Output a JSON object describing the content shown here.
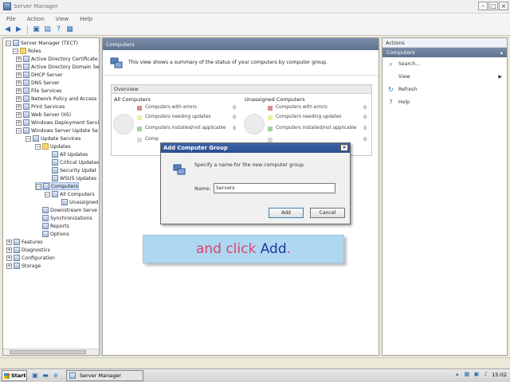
{
  "window": {
    "title": "Server Manager"
  },
  "menu": [
    "File",
    "Action",
    "View",
    "Help"
  ],
  "tree": {
    "items": [
      {
        "label": "Server Manager (TECT)"
      },
      {
        "label": "Roles"
      },
      {
        "label": "Active Directory Certificate"
      },
      {
        "label": "Active Directory Domain Se"
      },
      {
        "label": "DHCP Server"
      },
      {
        "label": "DNS Server"
      },
      {
        "label": "File Services"
      },
      {
        "label": "Network Policy and Access"
      },
      {
        "label": "Print Services"
      },
      {
        "label": "Web Server (IIS)"
      },
      {
        "label": "Windows Deployment Servi"
      },
      {
        "label": "Windows Server Update Se"
      },
      {
        "label": "Update Services"
      },
      {
        "label": "Updates"
      },
      {
        "label": "All Updates"
      },
      {
        "label": "Critical Updates"
      },
      {
        "label": "Security Updat"
      },
      {
        "label": "WSUS Updates"
      },
      {
        "label": "Computers"
      },
      {
        "label": "All Computers"
      },
      {
        "label": "Unassigned"
      },
      {
        "label": "Downstream Serve"
      },
      {
        "label": "Synchronizations"
      },
      {
        "label": "Reports"
      },
      {
        "label": "Options"
      },
      {
        "label": "Features"
      },
      {
        "label": "Diagnostics"
      },
      {
        "label": "Configuration"
      },
      {
        "label": "Storage"
      }
    ]
  },
  "center": {
    "header": "Computers",
    "description": "This view shows a summary of the status of your computers by computer group.",
    "overview_title": "Overview",
    "all": {
      "title": "All Computers",
      "rows": [
        {
          "label": "Computers with errors",
          "count": "0",
          "color": "#d98b91"
        },
        {
          "label": "Computers needing updates",
          "count": "0",
          "color": "#efef9d"
        },
        {
          "label": "Computers installed/not applicable",
          "count": "0",
          "color": "#9fd39a"
        },
        {
          "label": "Comp",
          "count": "",
          "color": "#d9d9d9"
        }
      ]
    },
    "unassigned": {
      "title": "Unassigned Computers",
      "rows": [
        {
          "label": "Computers with errors",
          "count": "0",
          "color": "#d98b91"
        },
        {
          "label": "Computers needing updates",
          "count": "0",
          "color": "#efef9d"
        },
        {
          "label": "Computers installed/not applicable",
          "count": "0",
          "color": "#9fd39a"
        },
        {
          "label": "",
          "count": "0",
          "color": "#d9d9d9"
        }
      ]
    }
  },
  "actions": {
    "header": "Actions",
    "subheader": "Computers",
    "items": [
      {
        "label": "Search...",
        "icon": "search-icon"
      },
      {
        "label": "View",
        "icon": ""
      },
      {
        "label": "Refresh",
        "icon": "refresh-icon"
      },
      {
        "label": "Help",
        "icon": "help-icon"
      }
    ]
  },
  "dialog": {
    "title": "Add Computer Group",
    "instruction": "Specify a name for the new computer group.",
    "name_label": "Name:",
    "name_value": "Servers",
    "add_label": "Add",
    "cancel_label": "Cancel"
  },
  "caption": {
    "part1": "and click ",
    "part2": "Add",
    "part3": "."
  },
  "taskbar": {
    "start": "Start",
    "task": "Server Manager",
    "clock": "15:02"
  }
}
